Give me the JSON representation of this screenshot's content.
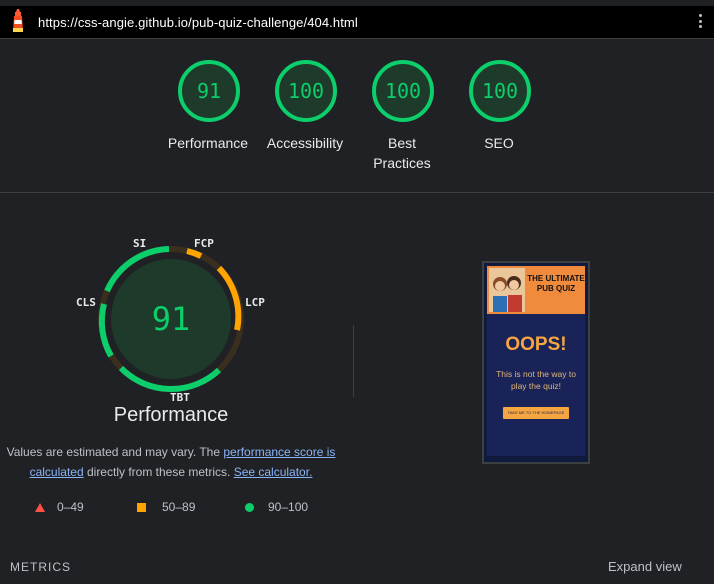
{
  "url": "https://css-angie.github.io/pub-quiz-challenge/404.html",
  "colors": {
    "pass": "#0cce6b",
    "average": "#ffa400",
    "fail": "#ff4e42",
    "link": "#8ab4f8"
  },
  "categories": [
    {
      "label": "Performance",
      "score": 91
    },
    {
      "label": "Accessibility",
      "score": 100
    },
    {
      "label": "Best Practices",
      "score": 100,
      "label_line1": "Best",
      "label_line2": "Practices"
    },
    {
      "label": "SEO",
      "score": 100
    }
  ],
  "performance": {
    "score": "91",
    "title": "Performance",
    "metrics": {
      "si": "SI",
      "fcp": "FCP",
      "lcp": "LCP",
      "tbt": "TBT",
      "cls": "CLS"
    },
    "note_prefix": "Values are estimated and may vary. The ",
    "note_link1": "performance score is calculated",
    "note_middle": " directly from these metrics. ",
    "note_link2": "See calculator."
  },
  "legend": {
    "fail": "0–49",
    "average": "50–89",
    "pass": "90–100"
  },
  "screenshot": {
    "title": "THE ULTIMATE PUB QUIZ",
    "heading": "OOPS!",
    "text": "This is not the way to play the quiz!",
    "button": "TAKE ME TO THE HOMEPAGE"
  },
  "footer": {
    "metrics_label": "METRICS",
    "expand_label": "Expand view"
  }
}
